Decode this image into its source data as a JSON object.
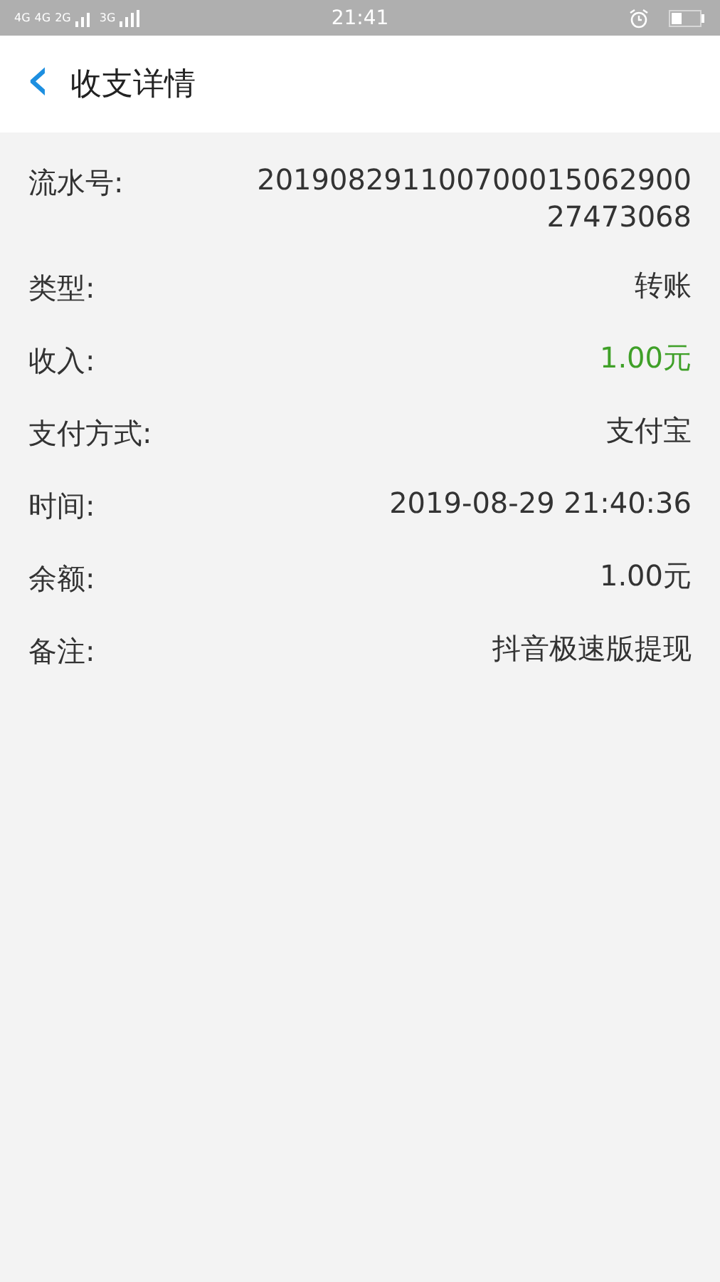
{
  "status_bar": {
    "networks": [
      "4G",
      "4G",
      "3G"
    ],
    "network_sub": "2G",
    "time": "21:41"
  },
  "header": {
    "back": "‹",
    "title": "收支详情"
  },
  "rows": [
    {
      "label": "流水号:",
      "value": "201908291100700015062900\n27473068",
      "kind": "plain"
    },
    {
      "label": "类型:",
      "value": "转账",
      "kind": "plain"
    },
    {
      "label": "收入:",
      "value": "1.00元",
      "kind": "income"
    },
    {
      "label": "支付方式:",
      "value": "支付宝",
      "kind": "plain"
    },
    {
      "label": "时间:",
      "value": "2019-08-29 21:40:36",
      "kind": "plain"
    },
    {
      "label": "余额:",
      "value": "1.00元",
      "kind": "plain"
    },
    {
      "label": "备注:",
      "value": "抖音极速版提现",
      "kind": "plain"
    }
  ]
}
